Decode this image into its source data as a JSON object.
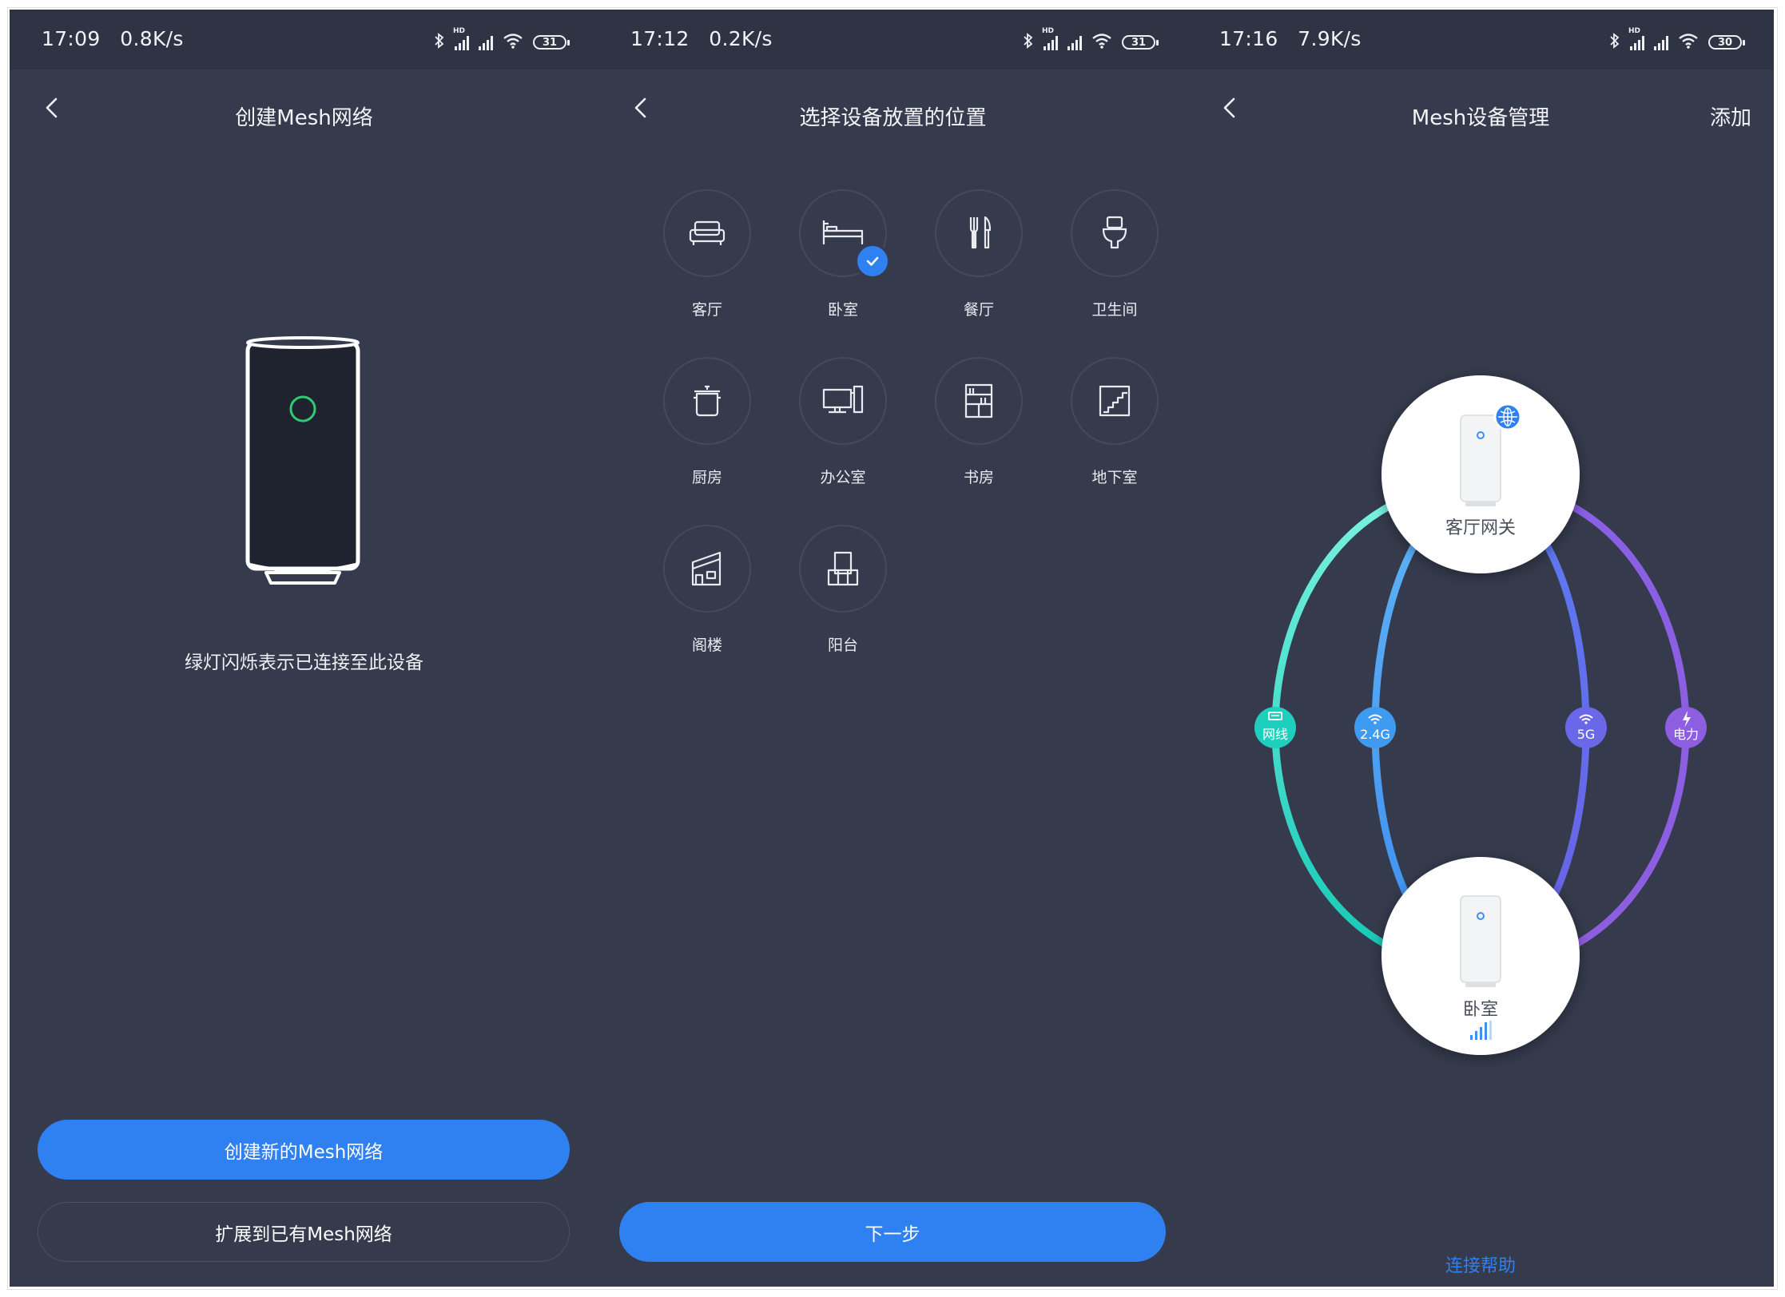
{
  "screens": [
    {
      "status": {
        "time": "17:09",
        "speed": "0.8K/s",
        "battery": "31"
      },
      "nav": {
        "title": "创建Mesh网络"
      },
      "caption": "绿灯闪烁表示已连接至此设备",
      "buttons": {
        "primary": "创建新的Mesh网络",
        "secondary": "扩展到已有Mesh网络"
      }
    },
    {
      "status": {
        "time": "17:12",
        "speed": "0.2K/s",
        "battery": "31"
      },
      "nav": {
        "title": "选择设备放置的位置"
      },
      "locations": [
        {
          "label": "客厅",
          "icon": "sofa-icon",
          "selected": false
        },
        {
          "label": "卧室",
          "icon": "bed-icon",
          "selected": true
        },
        {
          "label": "餐厅",
          "icon": "cutlery-icon",
          "selected": false
        },
        {
          "label": "卫生间",
          "icon": "toilet-icon",
          "selected": false
        },
        {
          "label": "厨房",
          "icon": "pot-icon",
          "selected": false
        },
        {
          "label": "办公室",
          "icon": "computer-icon",
          "selected": false
        },
        {
          "label": "书房",
          "icon": "bookshelf-icon",
          "selected": false
        },
        {
          "label": "地下室",
          "icon": "stairs-icon",
          "selected": false
        },
        {
          "label": "阁楼",
          "icon": "attic-icon",
          "selected": false
        },
        {
          "label": "阳台",
          "icon": "balcony-icon",
          "selected": false
        }
      ],
      "buttons": {
        "next": "下一步"
      }
    },
    {
      "status": {
        "time": "17:16",
        "speed": "7.9K/s",
        "battery": "30"
      },
      "nav": {
        "title": "Mesh设备管理",
        "action": "添加"
      },
      "nodes": {
        "gateway": "客厅网关",
        "bedroom": "卧室"
      },
      "links": [
        {
          "label": "网线",
          "icon": "ethernet-icon",
          "color": "#23d0c0"
        },
        {
          "label": "2.4G",
          "icon": "wifi-icon",
          "color": "#3f9bf0"
        },
        {
          "label": "5G",
          "icon": "wifi-icon",
          "color": "#6a67e8"
        },
        {
          "label": "电力",
          "icon": "power-icon",
          "color": "#8e5ee0"
        }
      ],
      "help": "连接帮助"
    }
  ],
  "colors": {
    "background": "#353a4c",
    "statusbar": "#2f3444",
    "accent": "#2f80f0",
    "led": "#2ecc71"
  }
}
